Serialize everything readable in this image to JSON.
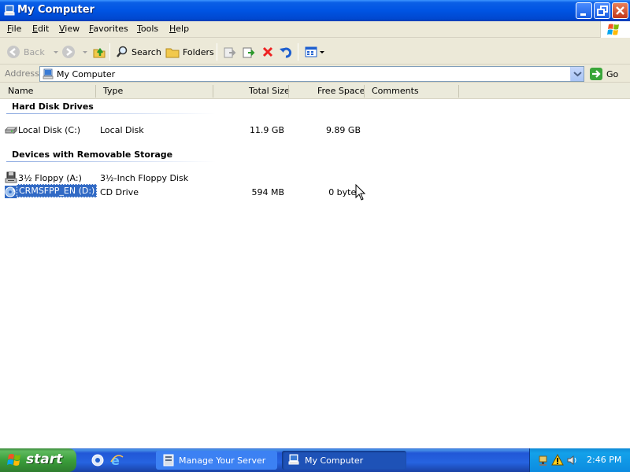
{
  "window": {
    "title": "My Computer",
    "icon": "my-computer-icon"
  },
  "menu": [
    {
      "label": "File",
      "accel": "F",
      "rest": "ile"
    },
    {
      "label": "Edit",
      "accel": "E",
      "rest": "dit"
    },
    {
      "label": "View",
      "accel": "V",
      "rest": "iew"
    },
    {
      "label": "Favorites",
      "accel": "F",
      "rest": "avorites"
    },
    {
      "label": "Tools",
      "accel": "T",
      "rest": "ools"
    },
    {
      "label": "Help",
      "accel": "H",
      "rest": "elp"
    }
  ],
  "toolbar": {
    "back_label": "Back",
    "search_label": "Search",
    "folders_label": "Folders"
  },
  "address": {
    "label": "Address",
    "value": "My Computer",
    "go_label": "Go"
  },
  "columns": {
    "name": "Name",
    "type": "Type",
    "total_size": "Total Size",
    "free_space": "Free Space",
    "comments": "Comments"
  },
  "groups": [
    {
      "title": "Hard Disk Drives",
      "items": [
        {
          "name": "Local Disk (C:)",
          "type": "Local Disk",
          "total_size": "11.9 GB",
          "free_space": "9.89 GB",
          "icon": "hard-disk-icon",
          "selected": false
        }
      ]
    },
    {
      "title": "Devices with Removable Storage",
      "items": [
        {
          "name": "3½ Floppy (A:)",
          "type": "3½-Inch Floppy Disk",
          "total_size": "",
          "free_space": "",
          "icon": "floppy-drive-icon",
          "selected": false
        },
        {
          "name": "CRMSFPP_EN (D:)",
          "type": "CD Drive",
          "total_size": "594 MB",
          "free_space": "0 bytes",
          "icon": "cd-drive-icon",
          "selected": true
        }
      ]
    }
  ],
  "taskbar": {
    "start_label": "start",
    "tasks": [
      {
        "label": "Manage Your Server",
        "icon": "server-icon",
        "active": false
      },
      {
        "label": "My Computer",
        "icon": "my-computer-icon",
        "active": true
      }
    ],
    "clock": "2:46 PM"
  },
  "colors": {
    "titlebar_blue": "#0054e3",
    "selection_blue": "#316ac5",
    "start_green": "#3a9e3a",
    "tray_blue": "#13a1ea"
  }
}
